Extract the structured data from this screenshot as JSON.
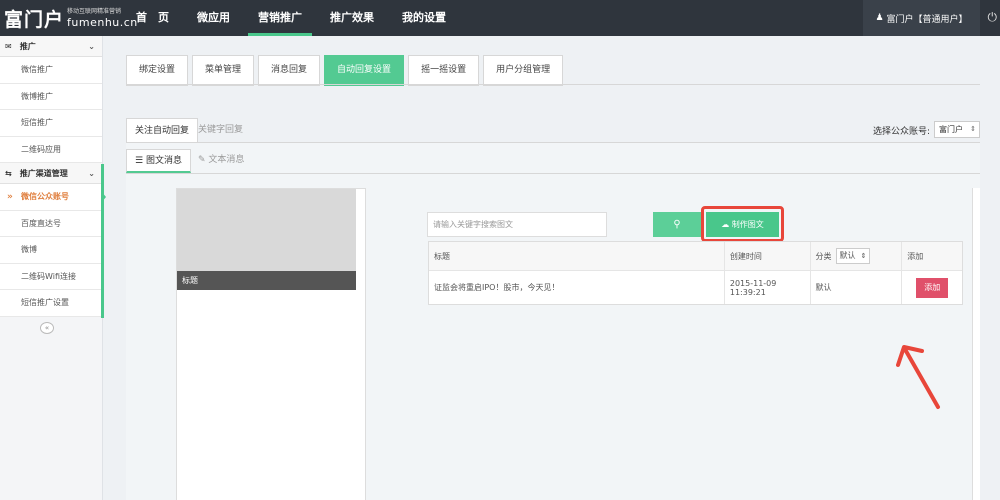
{
  "brand": {
    "name": "富门户",
    "slogan": "移动互联网精准营销",
    "url": "fumenhu.cn"
  },
  "nav": {
    "items": [
      "首　页",
      "微应用",
      "营销推广",
      "推广效果",
      "我的设置"
    ],
    "active": 2
  },
  "user": {
    "label": "富门户【普通用户】"
  },
  "sidebar": {
    "group1": {
      "title": "推广",
      "items": [
        "微信推广",
        "微博推广",
        "短信推广",
        "二维码应用"
      ]
    },
    "group2": {
      "title": "推广渠道管理",
      "items": [
        "微信公众账号",
        "百度直达号",
        "微博",
        "二维码Wifi连接",
        "短信推广设置"
      ],
      "active": 0
    }
  },
  "tabs": {
    "items": [
      "绑定设置",
      "菜单管理",
      "消息回复",
      "自动回复设置",
      "摇一摇设置",
      "用户分组管理"
    ],
    "active": 3
  },
  "subtabs": {
    "follow": "关注自动回复",
    "keyword": "关键字回复"
  },
  "account": {
    "label": "选择公众账号:",
    "value": "富门户"
  },
  "msgtabs": {
    "news": "图文消息",
    "text": "文本消息"
  },
  "preview": {
    "caption": "标题"
  },
  "search": {
    "placeholder": "请输入关键字搜索图文"
  },
  "make_button": "制作图文",
  "table": {
    "headers": [
      "标题",
      "创建时间",
      "分类",
      "添加"
    ],
    "filter_value": "默认",
    "rows": [
      {
        "title": "证监会将重启IPO！股市，今天见！",
        "time": "2015-11-09 11:39:21",
        "category": "默认",
        "action": "添加"
      }
    ]
  },
  "colors": {
    "accent": "#49c78b",
    "highlight": "#e8463a",
    "add": "#e0506a"
  }
}
